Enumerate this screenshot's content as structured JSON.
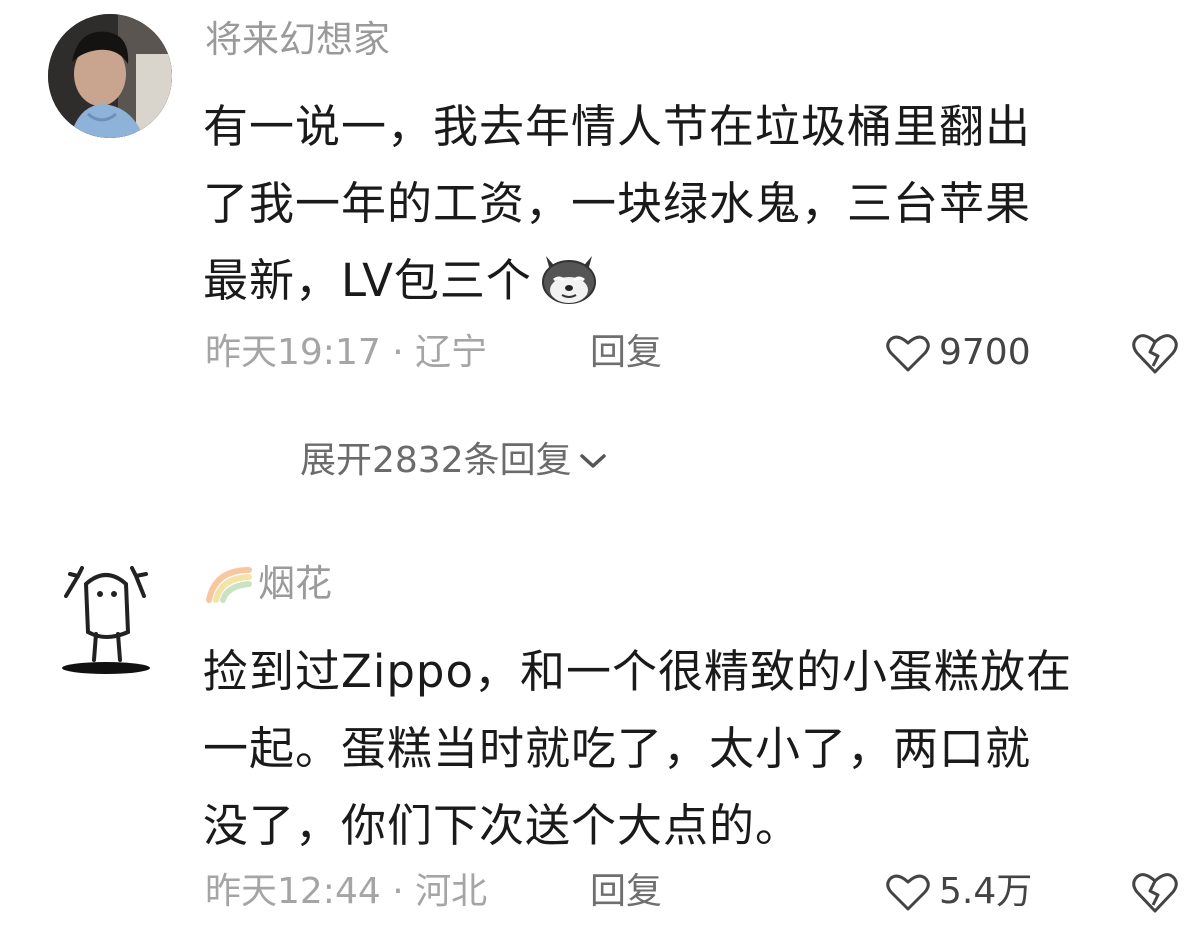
{
  "comments": [
    {
      "username": "将来幻想家",
      "lines": [
        "有一说一，我去年情人节在垃圾桶里翻出",
        "了我一年的工资，一块绿水鬼，三台苹果",
        "最新，LV包三个"
      ],
      "emoji": "dog-emoji",
      "time": "昨天19:17 · 辽宁",
      "reply_label": "回复",
      "likes": "9700",
      "expand_label": "展开2832条回复"
    },
    {
      "username": "烟花",
      "badge": "rainbow-badge",
      "lines": [
        "捡到过Zippo，和一个很精致的小蛋糕放在",
        "一起。蛋糕当时就吃了，太小了，两口就",
        "没了，你们下次送个大点的。"
      ],
      "time": "昨天12:44 · 河北",
      "reply_label": "回复",
      "likes": "5.4万"
    }
  ],
  "icons": {
    "like": "heart-icon",
    "dislike": "broken-heart-icon",
    "expand": "chevron-down-icon"
  }
}
